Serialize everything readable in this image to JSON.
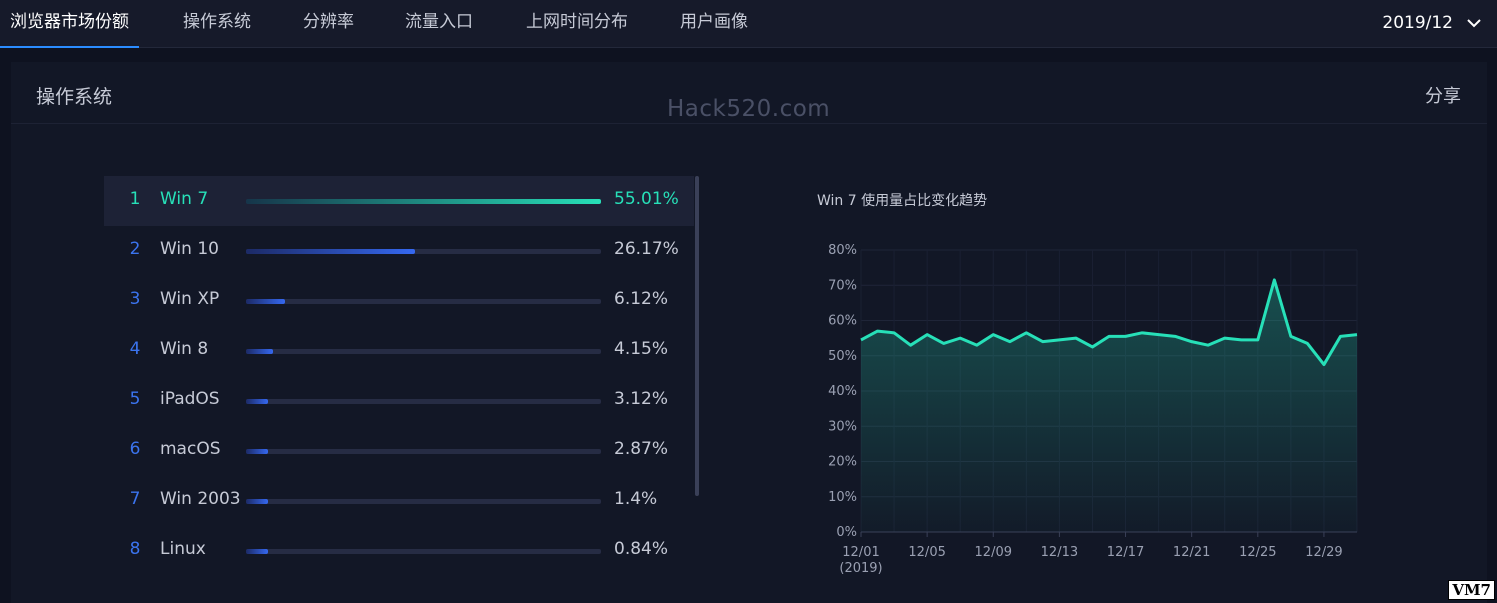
{
  "nav": {
    "tabs": [
      {
        "label": "浏览器市场份额",
        "active": true
      },
      {
        "label": "操作系统",
        "active": false
      },
      {
        "label": "分辨率",
        "active": false
      },
      {
        "label": "流量入口",
        "active": false
      },
      {
        "label": "上网时间分布",
        "active": false
      },
      {
        "label": "用户画像",
        "active": false
      }
    ],
    "month": "2019/12"
  },
  "panel": {
    "title": "操作系统",
    "share_label": "分享",
    "watermark": "Hack520.com"
  },
  "ranking": [
    {
      "rank": "1",
      "name": "Win 7",
      "percent": "55.01%",
      "value": 55.01
    },
    {
      "rank": "2",
      "name": "Win 10",
      "percent": "26.17%",
      "value": 26.17
    },
    {
      "rank": "3",
      "name": "Win XP",
      "percent": "6.12%",
      "value": 6.12
    },
    {
      "rank": "4",
      "name": "Win 8",
      "percent": "4.15%",
      "value": 4.15
    },
    {
      "rank": "5",
      "name": "iPadOS",
      "percent": "3.12%",
      "value": 3.12
    },
    {
      "rank": "6",
      "name": "macOS",
      "percent": "2.87%",
      "value": 2.87
    },
    {
      "rank": "7",
      "name": "Win 2003",
      "percent": "1.4%",
      "value": 1.4
    },
    {
      "rank": "8",
      "name": "Linux",
      "percent": "0.84%",
      "value": 0.84
    }
  ],
  "chart_data": {
    "type": "area",
    "title": "Win 7 使用量占比变化趋势",
    "x": [
      "12/01",
      "12/02",
      "12/03",
      "12/04",
      "12/05",
      "12/06",
      "12/07",
      "12/08",
      "12/09",
      "12/10",
      "12/11",
      "12/12",
      "12/13",
      "12/14",
      "12/15",
      "12/16",
      "12/17",
      "12/18",
      "12/19",
      "12/20",
      "12/21",
      "12/22",
      "12/23",
      "12/24",
      "12/25",
      "12/26",
      "12/27",
      "12/28",
      "12/29",
      "12/30",
      "12/31"
    ],
    "x_ticks": [
      "12/01",
      "12/05",
      "12/09",
      "12/13",
      "12/17",
      "12/21",
      "12/25",
      "12/29"
    ],
    "x_first_sublabel": "(2019)",
    "values": [
      54.5,
      57,
      56.5,
      53,
      56,
      53.5,
      55,
      53,
      56,
      54,
      56.5,
      54,
      54.5,
      55,
      52.5,
      55.5,
      55.5,
      56.5,
      56,
      55.5,
      54,
      53,
      55,
      54.5,
      54.5,
      71.5,
      55.5,
      53.5,
      47.5,
      55.5,
      56
    ],
    "y_ticks": [
      "80%",
      "70%",
      "60%",
      "50%",
      "40%",
      "30%",
      "20%",
      "10%",
      "0%"
    ],
    "ylim": [
      0,
      80
    ],
    "grid": true,
    "line_color": "#27e0b8"
  },
  "corner_badge": "VM7"
}
